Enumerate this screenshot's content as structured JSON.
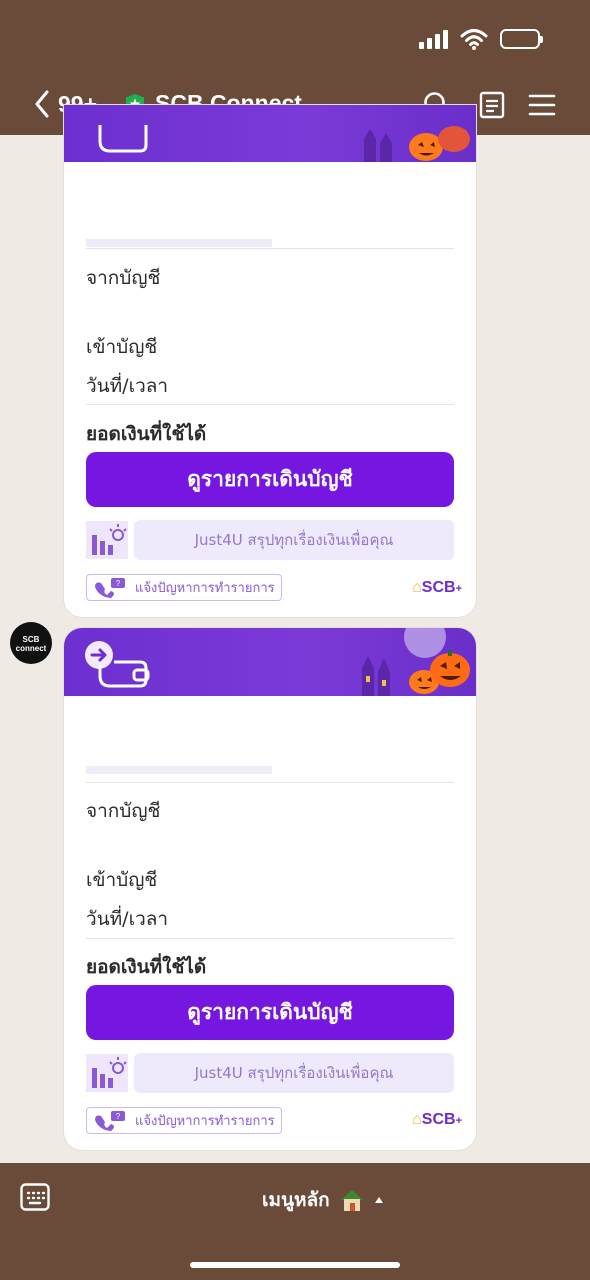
{
  "header": {
    "back_count": "99+",
    "title": "SCB Connect"
  },
  "avatar": {
    "line1": "SCB",
    "line2": "connect"
  },
  "cards": [
    {
      "from_account_label": "จากบัญชี",
      "to_account_label": "เข้าบัญชี",
      "datetime_label": "วันที่/เวลา",
      "available_balance_label": "ยอดเงินที่ใช้ได้",
      "view_statement_button": "ดูรายการเดินบัญชี",
      "just4u_text": "Just4U สรุปทุกเรื่องเงินเพื่อคุณ",
      "report_problem_text": "แจ้งปัญหาการทำรายการ",
      "brand": "SCB"
    },
    {
      "from_account_label": "จากบัญชี",
      "to_account_label": "เข้าบัญชี",
      "datetime_label": "วันที่/เวลา",
      "available_balance_label": "ยอดเงินที่ใช้ได้",
      "view_statement_button": "ดูรายการเดินบัญชี",
      "just4u_text": "Just4U สรุปทุกเรื่องเงินเพื่อคุณ",
      "report_problem_text": "แจ้งปัญหาการทำรายการ",
      "brand": "SCB"
    }
  ],
  "bottom": {
    "menu_label": "เมนูหลัก"
  },
  "colors": {
    "bar": "#6a4a38",
    "chat_bg": "#efebe4",
    "accent_purple": "#7616e1"
  }
}
